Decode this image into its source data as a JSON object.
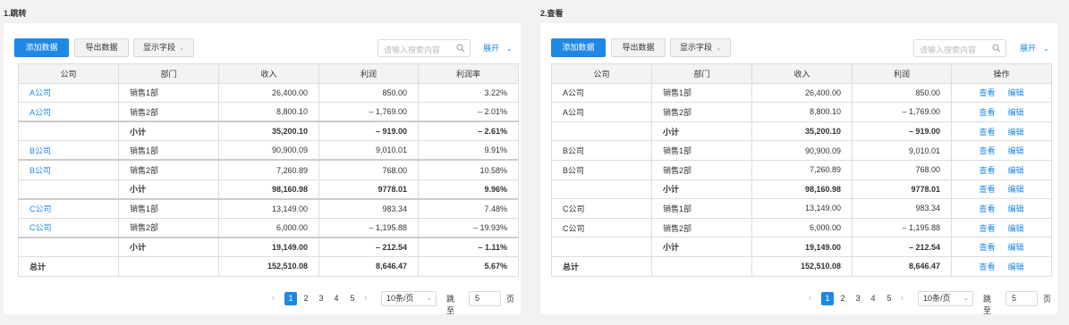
{
  "panels": [
    {
      "title": "1.跳转",
      "toolbar": {
        "add": "添加数据",
        "export": "导出数据",
        "fields": "显示字段",
        "search_placeholder": "请输入搜索内容",
        "expand": "展开"
      },
      "headers": [
        "公司",
        "部门",
        "收入",
        "利润",
        "利润率"
      ],
      "rows": [
        [
          "A公司",
          "销售1部",
          "26,400.00",
          "850.00",
          "3.22%"
        ],
        [
          "A公司",
          "销售2部",
          "8,800.10",
          "– 1,769.00",
          "– 2.01%"
        ],
        [
          "",
          "小计",
          "35,200.10",
          "– 919.00",
          "– 2.61%"
        ],
        [
          "B公司",
          "销售1部",
          "90,900.09",
          "9,010.01",
          "9.91%"
        ],
        [
          "B公司",
          "销售2部",
          "7,260.89",
          "768.00",
          "10.58%"
        ],
        [
          "",
          "小计",
          "98,160.98",
          "9778.01",
          "9.96%"
        ],
        [
          "C公司",
          "销售1部",
          "13,149.00",
          "983.34",
          "7.48%"
        ],
        [
          "C公司",
          "销售2部",
          "6,000.00",
          "– 1,195.88",
          "– 19.93%"
        ],
        [
          "",
          "小计",
          "19,149.00",
          "– 212.54",
          "– 1.11%"
        ],
        [
          "总计",
          "",
          "152,510.08",
          "8,646.47",
          "5.67%"
        ]
      ],
      "pager": {
        "prev": "‹",
        "pages": [
          "1",
          "2",
          "3",
          "4",
          "5"
        ],
        "next": "›",
        "page_size": "10条/页",
        "goto_label": "跳至",
        "goto_value": "5",
        "page_unit": "页"
      }
    },
    {
      "title": "2.查看",
      "toolbar": {
        "add": "添加数据",
        "export": "导出数据",
        "fields": "显示字段",
        "search_placeholder": "请输入搜索内容",
        "expand": "展开"
      },
      "headers": [
        "公司",
        "部门",
        "收入",
        "利润",
        "操作"
      ],
      "rows": [
        [
          "A公司",
          "销售1部",
          "26,400.00",
          "850.00"
        ],
        [
          "A公司",
          "销售2部",
          "8,800.10",
          "– 1,769.00"
        ],
        [
          "",
          "小计",
          "35,200.10",
          "– 919.00"
        ],
        [
          "B公司",
          "销售1部",
          "90,900.09",
          "9,010.01"
        ],
        [
          "B公司",
          "销售2部",
          "7,260.89",
          "768.00"
        ],
        [
          "",
          "小计",
          "98,160.98",
          "9778.01"
        ],
        [
          "C公司",
          "销售1部",
          "13,149.00",
          "983.34"
        ],
        [
          "C公司",
          "销售2部",
          "6,000.00",
          "– 1,195.88"
        ],
        [
          "",
          "小计",
          "19,149.00",
          "– 212.54"
        ],
        [
          "总计",
          "",
          "152,510.08",
          "8,646.47"
        ]
      ],
      "ops": {
        "view": "查看",
        "edit": "编辑"
      },
      "pager": {
        "prev": "‹",
        "pages": [
          "1",
          "2",
          "3",
          "4",
          "5"
        ],
        "next": "›",
        "page_size": "10条/页",
        "goto_label": "跳至",
        "goto_value": "5",
        "page_unit": "页"
      }
    }
  ],
  "colors": {
    "accent": "#1e88e5",
    "header_bg": "#f3f3f3",
    "border": "#dcdcdc"
  }
}
